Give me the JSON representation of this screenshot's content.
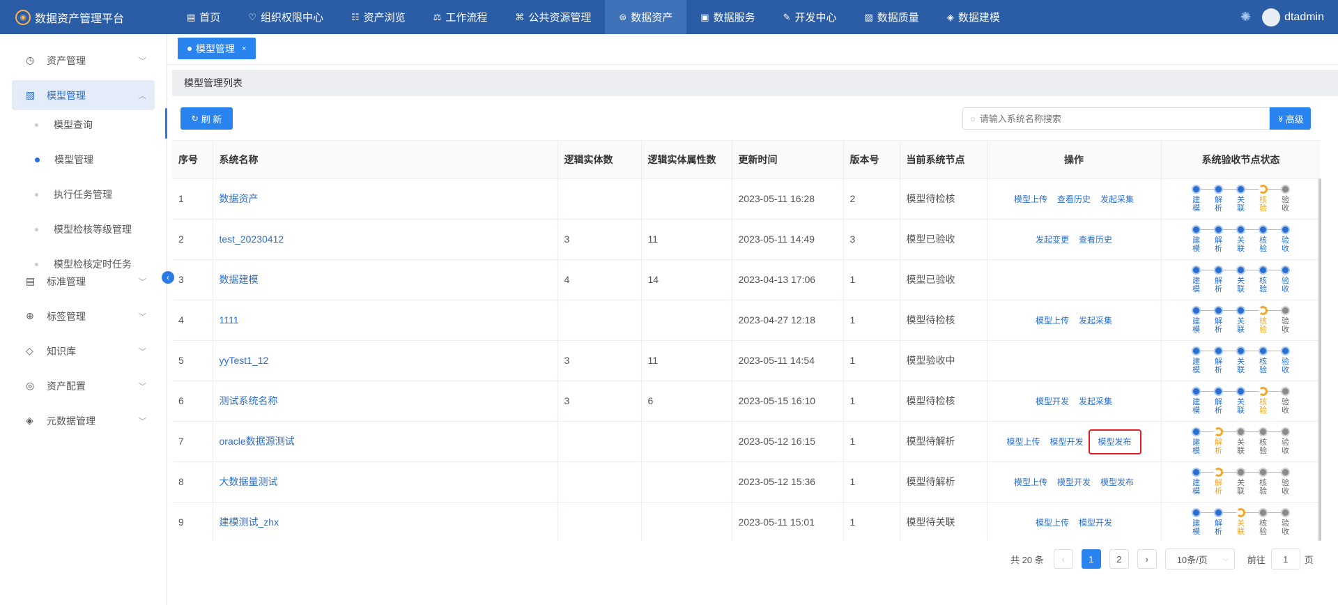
{
  "app": {
    "title": "数据资产管理平台"
  },
  "nav": [
    {
      "label": "首页",
      "icon": "document-icon"
    },
    {
      "label": "组织权限中心",
      "icon": "shield-icon"
    },
    {
      "label": "资产浏览",
      "icon": "list-icon"
    },
    {
      "label": "工作流程",
      "icon": "scale-icon"
    },
    {
      "label": "公共资源管理",
      "icon": "gamepad-icon"
    },
    {
      "label": "数据资产",
      "icon": "database-icon",
      "active": true
    },
    {
      "label": "数据服务",
      "icon": "monitor-icon"
    },
    {
      "label": "开发中心",
      "icon": "edit-icon"
    },
    {
      "label": "数据质量",
      "icon": "chart-icon"
    },
    {
      "label": "数据建模",
      "icon": "layers-icon"
    }
  ],
  "user": {
    "name": "dtadmin"
  },
  "sidebar": {
    "items": [
      {
        "label": "资产管理",
        "icon": "clock-icon"
      },
      {
        "label": "模型管理",
        "icon": "chart-icon",
        "active": true
      },
      {
        "label": "标准管理",
        "icon": "document-icon"
      },
      {
        "label": "标签管理",
        "icon": "plus-circle-icon"
      },
      {
        "label": "知识库",
        "icon": "tag-icon"
      },
      {
        "label": "资产配置",
        "icon": "target-icon"
      },
      {
        "label": "元数据管理",
        "icon": "layers-icon"
      }
    ],
    "subitems": [
      {
        "label": "模型查询"
      },
      {
        "label": "模型管理",
        "active": true
      },
      {
        "label": "执行任务管理"
      },
      {
        "label": "模型检核等级管理"
      },
      {
        "label": "模型检核定时任务"
      }
    ]
  },
  "tab": {
    "label": "模型管理",
    "close": "×"
  },
  "section": {
    "title": "模型管理列表"
  },
  "toolbar": {
    "refresh_label": "刷 新",
    "refresh_icon": "↻",
    "search_placeholder": "请输入系统名称搜索",
    "advanced_label": "高级",
    "advanced_icon": "≫"
  },
  "table": {
    "headers": [
      "序号",
      "系统名称",
      "逻辑实体数",
      "逻辑实体属性数",
      "更新时间",
      "版本号",
      "当前系统节点",
      "操作",
      "系统验收节点状态"
    ],
    "step_labels": [
      "建模",
      "解析",
      "关联",
      "核验",
      "验收"
    ],
    "rows": [
      {
        "idx": "1",
        "name": "数据资产",
        "entities": "",
        "attrs": "",
        "time": "2023-05-11 16:28",
        "version": "2",
        "node": "模型待检核",
        "ops": [
          "模型上传",
          "查看历史",
          "发起采集"
        ],
        "steps": [
          "done",
          "done",
          "done",
          "cur",
          "todo"
        ]
      },
      {
        "idx": "2",
        "name": "test_20230412",
        "entities": "3",
        "attrs": "11",
        "time": "2023-05-11 14:49",
        "version": "3",
        "node": "模型已验收",
        "ops": [
          "发起变更",
          "查看历史"
        ],
        "steps": [
          "done",
          "done",
          "done",
          "done",
          "done"
        ]
      },
      {
        "idx": "3",
        "name": "数据建模",
        "entities": "4",
        "attrs": "14",
        "time": "2023-04-13 17:06",
        "version": "1",
        "node": "模型已验收",
        "ops": [],
        "steps": [
          "done",
          "done",
          "done",
          "done",
          "done"
        ]
      },
      {
        "idx": "4",
        "name": "1111",
        "entities": "",
        "attrs": "",
        "time": "2023-04-27 12:18",
        "version": "1",
        "node": "模型待检核",
        "ops": [
          "模型上传",
          "发起采集"
        ],
        "steps": [
          "done",
          "done",
          "done",
          "cur",
          "todo"
        ]
      },
      {
        "idx": "5",
        "name": "yyTest1_12",
        "entities": "3",
        "attrs": "11",
        "time": "2023-05-11 14:54",
        "version": "1",
        "node": "模型验收中",
        "ops": [],
        "steps": [
          "done",
          "done",
          "done",
          "done",
          "done"
        ]
      },
      {
        "idx": "6",
        "name": "测试系统名称",
        "entities": "3",
        "attrs": "6",
        "time": "2023-05-15 16:10",
        "version": "1",
        "node": "模型待检核",
        "ops": [
          "模型开发",
          "发起采集"
        ],
        "steps": [
          "done",
          "done",
          "done",
          "cur",
          "todo"
        ]
      },
      {
        "idx": "7",
        "name": "oracle数据源测试",
        "entities": "",
        "attrs": "",
        "time": "2023-05-12 16:15",
        "version": "1",
        "node": "模型待解析",
        "ops": [
          "模型上传",
          "模型开发",
          "模型发布"
        ],
        "highlight": 2,
        "steps": [
          "done",
          "cur",
          "todo",
          "todo",
          "todo"
        ]
      },
      {
        "idx": "8",
        "name": "大数据量测试",
        "entities": "",
        "attrs": "",
        "time": "2023-05-12 15:36",
        "version": "1",
        "node": "模型待解析",
        "ops": [
          "模型上传",
          "模型开发",
          "模型发布"
        ],
        "steps": [
          "done",
          "cur",
          "todo",
          "todo",
          "todo"
        ]
      },
      {
        "idx": "9",
        "name": "建模测试_zhx",
        "entities": "",
        "attrs": "",
        "time": "2023-05-11 15:01",
        "version": "1",
        "node": "模型待关联",
        "ops": [
          "模型上传",
          "模型开发"
        ],
        "steps": [
          "done",
          "done",
          "cur",
          "todo",
          "todo"
        ]
      }
    ]
  },
  "pager": {
    "total": "共 20 条",
    "pages": [
      "1",
      "2"
    ],
    "current": "1",
    "prev": "‹",
    "next": "›",
    "size": "10条/页",
    "goto": "前往",
    "goto_value": "1",
    "page_unit": "页"
  },
  "colors": {
    "topbar": "#2a5da6",
    "accent": "#2a84f0",
    "highlight": "#e02020"
  }
}
